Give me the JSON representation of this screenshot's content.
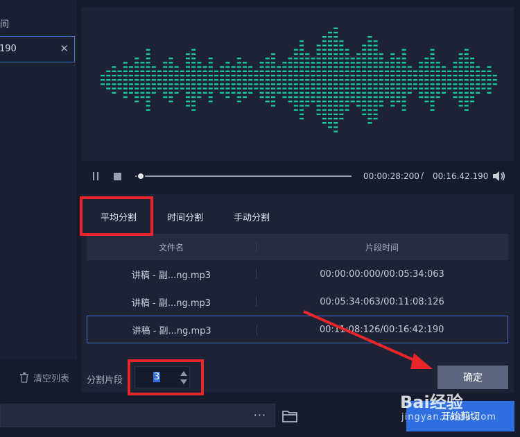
{
  "left_panel": {
    "label": "间",
    "time_value": "190",
    "clear_icon": "close-icon",
    "clear_list_label": "清空列表",
    "clear_list_icon": "trash-icon"
  },
  "waveform": {
    "color": "#19c89a",
    "levels": [
      1,
      2,
      3,
      2,
      4,
      3,
      5,
      4,
      7,
      3,
      2,
      4,
      5,
      3,
      2,
      6,
      7,
      4,
      3,
      5,
      2,
      3,
      4,
      3,
      5,
      4,
      3,
      2,
      4,
      5,
      6,
      3,
      4,
      5,
      7,
      9,
      6,
      5,
      8,
      10,
      11,
      12,
      9,
      7,
      5,
      6,
      8,
      10,
      9,
      6,
      4,
      6,
      5,
      7,
      3,
      2,
      4,
      5,
      7,
      4,
      3,
      2,
      4,
      6,
      7,
      5,
      3,
      2,
      3,
      1
    ]
  },
  "player": {
    "pause_icon": "pause-icon",
    "stop_icon": "stop-icon",
    "current_time": "00:00:28:200",
    "separator": "/",
    "total_time": "00:16.42.190",
    "volume_icon": "volume-icon",
    "progress": 0.02
  },
  "split": {
    "tabs": [
      "平均分割",
      "时间分割",
      "手动分割"
    ],
    "active_tab": 0,
    "table": {
      "headers": [
        "文件名",
        "片段时间"
      ],
      "rows": [
        {
          "file": "讲稿 - 副...ng.mp3",
          "time": "00:00:00:000/00:05:34:063"
        },
        {
          "file": "讲稿 - 副...ng.mp3",
          "time": "00:05:34:063/00:11:08:126"
        },
        {
          "file": "讲稿 - 副...ng.mp3",
          "time": "00:11:08:126/00:16:42:190"
        }
      ],
      "selected_row": 2
    },
    "segments_label": "分割片段",
    "segments_value": "3",
    "confirm_label": "确定"
  },
  "bottom": {
    "more_label": "···",
    "folder_icon": "folder-icon",
    "start_label": "开始剪切"
  },
  "watermark": {
    "main": "Bai经验",
    "sub": "jingyan.baidu.com"
  },
  "colors": {
    "accent": "#2f6fe0",
    "highlight": "#e6262b",
    "wave": "#19c89a"
  }
}
